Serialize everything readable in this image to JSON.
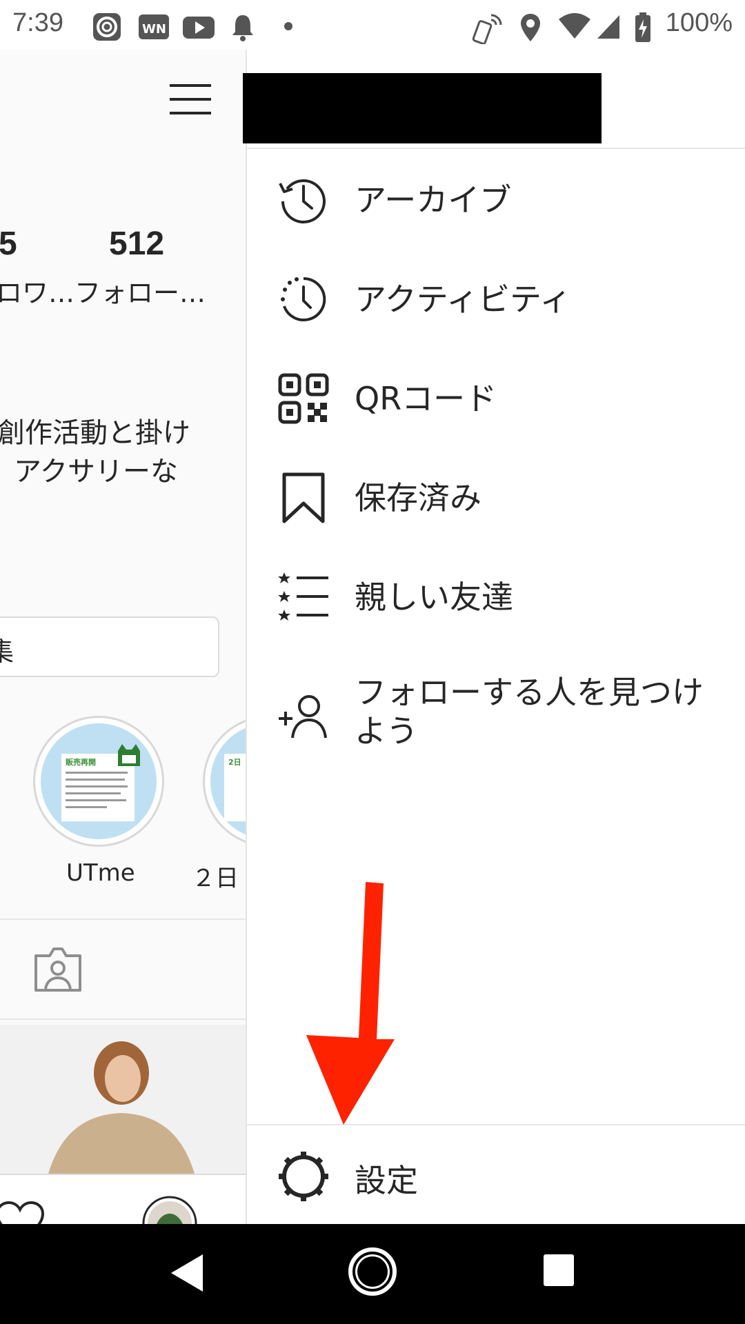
{
  "status_bar": {
    "time": "7:39",
    "icons": [
      "cc-icon",
      "wni-icon",
      "youtube-icon",
      "bell-icon",
      "dot-icon",
      "nfc-phone-icon",
      "location-icon",
      "wifi-icon",
      "signal-icon",
      "battery-charging-icon"
    ],
    "battery": "100%"
  },
  "profile": {
    "stats": [
      {
        "number": "5",
        "label": "ロワ…"
      },
      {
        "number": "512",
        "label": "フォロー…"
      }
    ],
    "bio_lines": [
      "創作活動と掛け",
      "アクサリーな"
    ],
    "edit_button_label": "集",
    "highlights": [
      {
        "label": "UTme",
        "card_title": "販売再開"
      },
      {
        "label": "２日",
        "card_title": "2日"
      }
    ]
  },
  "drawer": {
    "menu_items": [
      {
        "label": "アーカイブ",
        "icon": "archive-icon"
      },
      {
        "label": "アクティビティ",
        "icon": "activity-icon"
      },
      {
        "label": "QRコード",
        "icon": "qr-code-icon"
      },
      {
        "label": "保存済み",
        "icon": "bookmark-icon"
      },
      {
        "label": "親しい友達",
        "icon": "close-friends-icon"
      },
      {
        "label": "フォローする人を見つけよう",
        "icon": "add-person-icon"
      }
    ],
    "settings_label": "設定"
  },
  "nav_bar": {
    "buttons": [
      "back-icon",
      "home-icon",
      "recents-icon"
    ]
  },
  "colors": {
    "annotation_arrow": "#ff2200",
    "text": "#262626",
    "divider": "#e6e6e6"
  }
}
